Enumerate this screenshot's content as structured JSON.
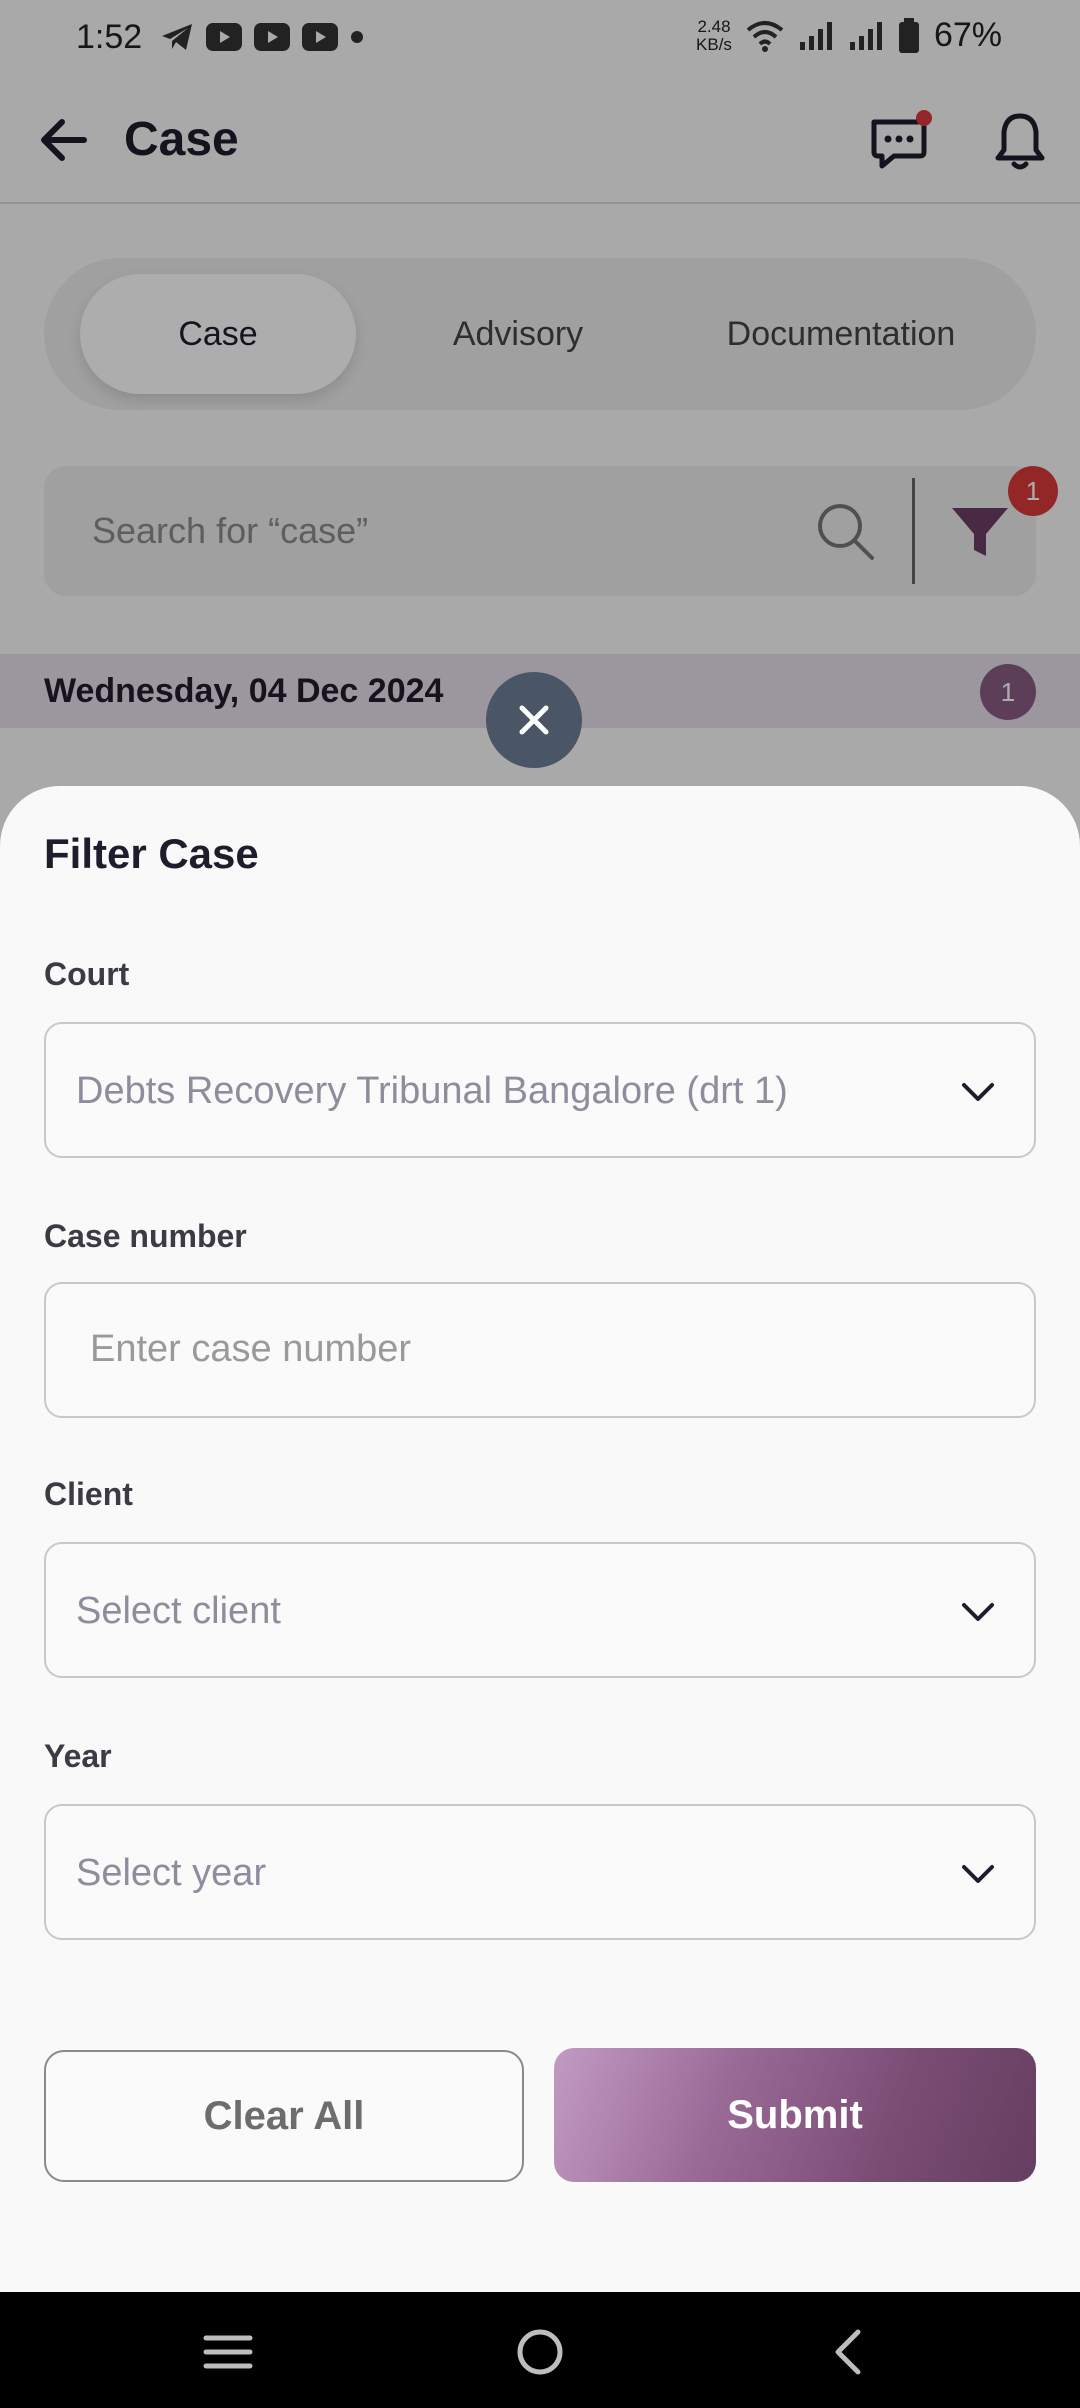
{
  "status_bar": {
    "time": "1:52",
    "net_speed_value": "2.48",
    "net_speed_unit": "KB/s",
    "battery": "67%"
  },
  "app_bar": {
    "title": "Case"
  },
  "tabs": [
    {
      "label": "Case",
      "active": true
    },
    {
      "label": "Advisory",
      "active": false
    },
    {
      "label": "Documentation",
      "active": false
    }
  ],
  "search": {
    "placeholder": "Search for “case”",
    "filter_badge": "1"
  },
  "date_row": {
    "date": "Wednesday, 04 Dec  2024",
    "count": "1"
  },
  "sheet": {
    "title": "Filter Case",
    "court": {
      "label": "Court",
      "value": "Debts Recovery Tribunal Bangalore (drt 1)"
    },
    "case_number": {
      "label": "Case number",
      "placeholder": "Enter case number"
    },
    "client": {
      "label": "Client",
      "placeholder": "Select client"
    },
    "year": {
      "label": "Year",
      "placeholder": "Select year"
    },
    "clear_label": "Clear All",
    "submit_label": "Submit"
  },
  "colors": {
    "accent": "#7a4c74",
    "badge_red": "#d93a3a",
    "close_button": "#4a5665"
  }
}
